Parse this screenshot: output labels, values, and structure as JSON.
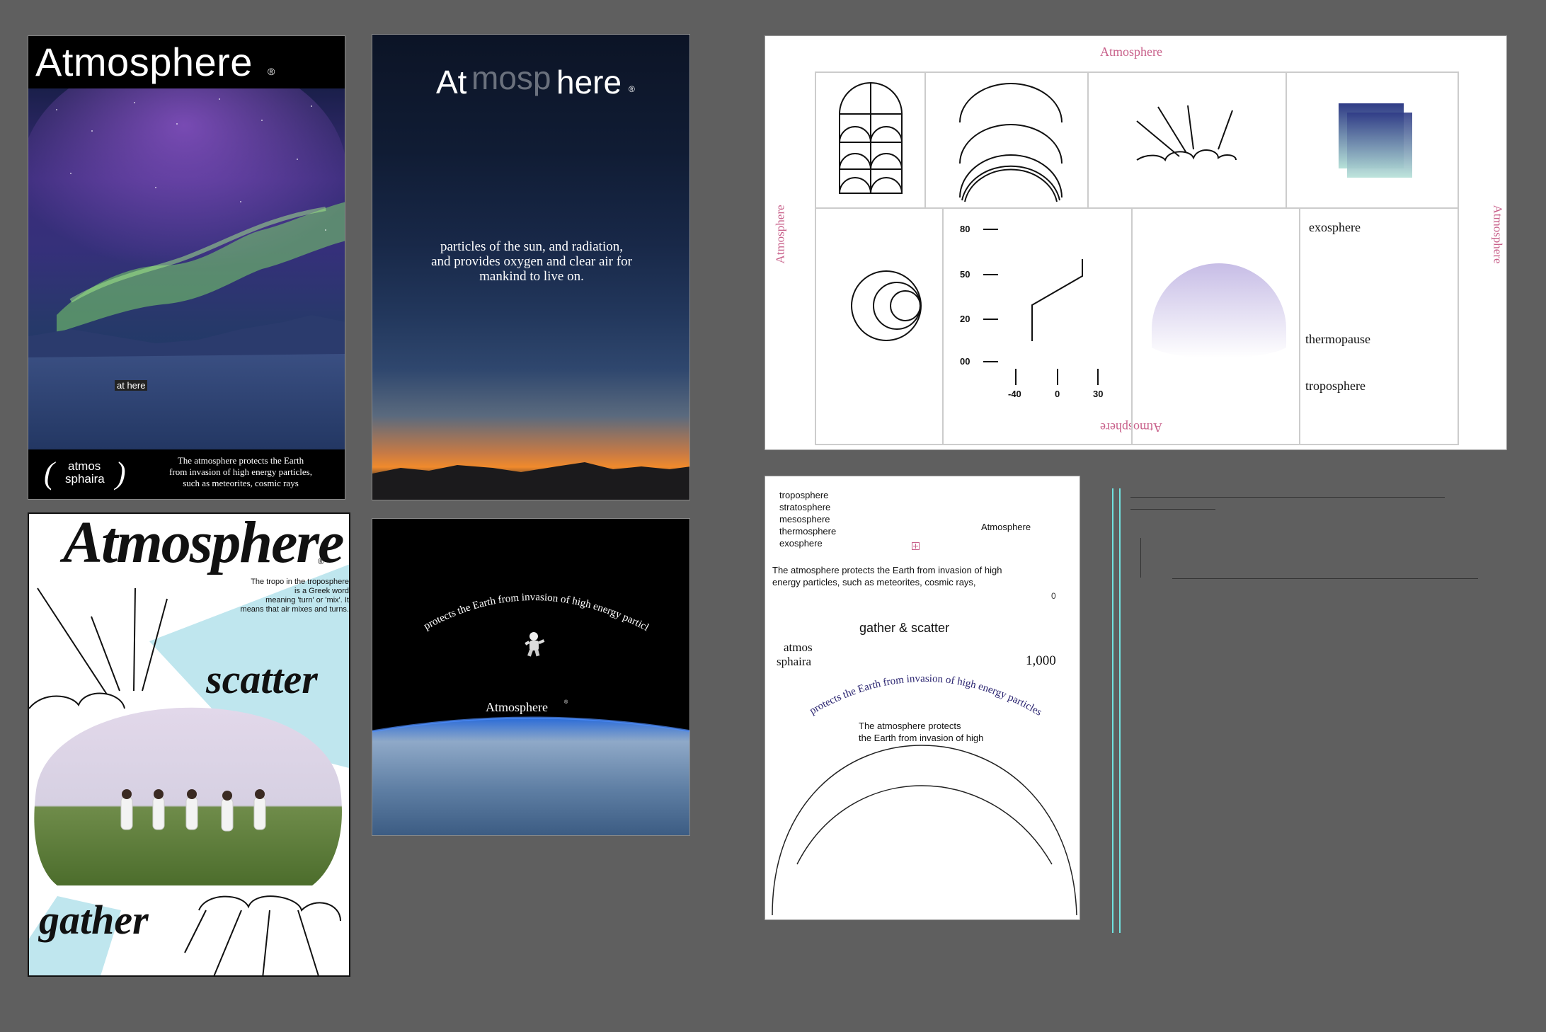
{
  "colors": {
    "canvas_bg": "#5f5f5f",
    "pink_accent": "#c8608a",
    "cyan_guide": "#6fe3e0",
    "navy_text": "#2a2470"
  },
  "poster_aurora": {
    "title": "Atmosphere",
    "registered": "®",
    "label": "at  here",
    "atmos": "atmos",
    "sphaira": "sphaira",
    "body_lines": [
      "The atmosphere protects the Earth",
      "from invasion of high energy particles,",
      "such as meteorites, cosmic rays"
    ]
  },
  "poster_sunset": {
    "title_at": "At",
    "title_ghost": "mosp",
    "title_here": "here",
    "registered": "®",
    "body_lines": [
      "particles of the sun, and radiation,",
      "and provides oxygen and clear air for",
      "mankind to live on."
    ]
  },
  "poster_gather": {
    "title": "Atmosphere",
    "registered": "®",
    "body_lines": [
      "The tropo in the troposphere",
      "is a Greek word",
      "meaning 'turn' or 'mix'. It",
      "means that air mixes and turns."
    ],
    "scatter": "scatter",
    "gather": "gather"
  },
  "poster_space": {
    "arc_text": "protects the Earth from invasion of high energy particles",
    "title": "Atmosphere",
    "registered": "®"
  },
  "icon_sheet": {
    "title_top": "Atmosphere",
    "title_left": "Atmosphere",
    "title_right": "Atmosphere",
    "title_bottom": "Atmosphere",
    "y_ticks": [
      "80",
      "50",
      "20",
      "00"
    ],
    "x_ticks": [
      "-40",
      "0",
      "30"
    ],
    "layers": [
      "exosphere",
      "thermopause",
      "troposphere"
    ]
  },
  "draft_sheet": {
    "layer_list": [
      "troposphere",
      "stratosphere",
      "mesosphere",
      "thermosphere",
      "exosphere"
    ],
    "title": "Atmosphere",
    "body_lines": [
      "The atmosphere protects the Earth from invasion of high",
      "energy particles, such as meteorites, cosmic rays,"
    ],
    "zero": "0",
    "gather_scatter": "gather & scatter",
    "atmos": "atmos",
    "sphaira": "sphaira",
    "number": "1,000",
    "arc_text": "protects the Earth from invasion of high energy particles",
    "body2_lines": [
      "The atmosphere protects",
      "the Earth from invasion of high"
    ]
  }
}
